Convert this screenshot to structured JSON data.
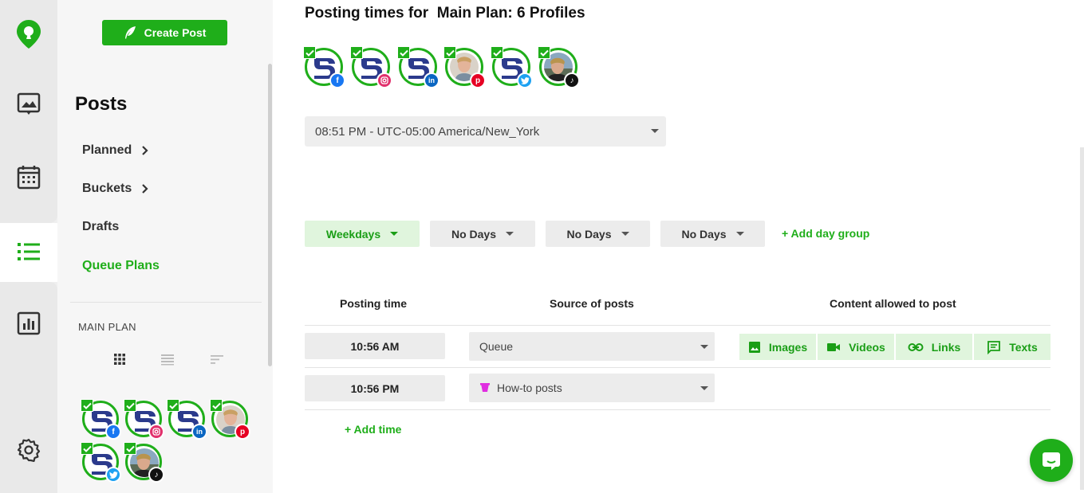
{
  "sidebar": {
    "create_post_label": "Create Post",
    "title": "Posts",
    "items": [
      {
        "label": "Planned",
        "has_chevron": true
      },
      {
        "label": "Buckets",
        "has_chevron": true
      },
      {
        "label": "Drafts",
        "has_chevron": false
      },
      {
        "label": "Queue Plans",
        "has_chevron": false,
        "active": true
      }
    ],
    "plan_label": "MAIN PLAN",
    "view_icons": [
      "grid-view-icon",
      "list-view-icon",
      "compact-view-icon"
    ],
    "profiles": [
      "facebook",
      "instagram",
      "linkedin",
      "pinterest",
      "twitter",
      "tiktok"
    ]
  },
  "rail": {
    "icons": [
      "logo-pin-icon",
      "media-library-icon",
      "calendar-icon",
      "posts-list-icon",
      "analytics-icon",
      "settings-icon"
    ],
    "active": "posts-list-icon"
  },
  "main": {
    "title": "Posting times for  Main Plan: 6 Profiles",
    "profiles": [
      "facebook",
      "instagram",
      "linkedin",
      "pinterest",
      "twitter",
      "tiktok"
    ],
    "timezone": "08:51 PM - UTC-05:00 America/New_York",
    "day_groups": [
      "Weekdays",
      "No Days",
      "No Days",
      "No Days"
    ],
    "add_day_group": "+ Add day group",
    "columns": [
      "Posting time",
      "Source of posts",
      "Content allowed to post"
    ],
    "rows": [
      {
        "time": "10:56 AM",
        "source": "Queue"
      },
      {
        "time": "10:56 PM",
        "source": "How-to posts"
      }
    ],
    "content_types": [
      "Images",
      "Videos",
      "Links",
      "Texts"
    ],
    "add_time": "+ Add time"
  },
  "colors": {
    "accent": "#1fae1a",
    "accent_light": "#e0f5dd",
    "facebook": "#1877f2",
    "instagram": "#e1306c",
    "linkedin": "#0a66c2",
    "pinterest": "#e60023",
    "twitter": "#1da1f2",
    "tiktok": "#111111",
    "bucket": "#e02de0"
  }
}
